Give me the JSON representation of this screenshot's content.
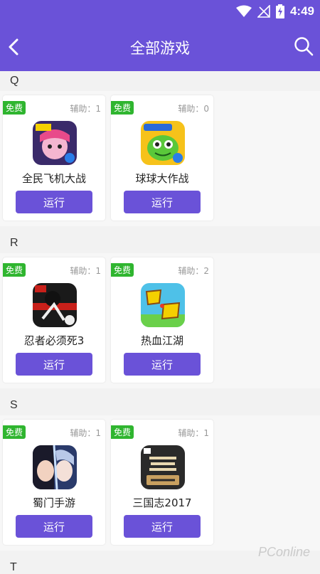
{
  "status_bar": {
    "time": "4:49"
  },
  "header": {
    "title": "全部游戏"
  },
  "sections": [
    {
      "letter": "Q",
      "games": [
        {
          "badge": "免费",
          "assist": "辅助：1",
          "name": "全民飞机大战",
          "button": "运行"
        },
        {
          "badge": "免费",
          "assist": "辅助：0",
          "name": "球球大作战",
          "button": "运行"
        }
      ]
    },
    {
      "letter": "R",
      "games": [
        {
          "badge": "免费",
          "assist": "辅助：1",
          "name": "忍者必须死3",
          "button": "运行"
        },
        {
          "badge": "免费",
          "assist": "辅助：2",
          "name": "热血江湖",
          "button": "运行"
        }
      ]
    },
    {
      "letter": "S",
      "games": [
        {
          "badge": "免费",
          "assist": "辅助：1",
          "name": "蜀门手游",
          "button": "运行"
        },
        {
          "badge": "免费",
          "assist": "辅助：1",
          "name": "三国志2017",
          "button": "运行"
        }
      ]
    },
    {
      "letter": "T",
      "games": []
    }
  ],
  "icons": {
    "back": "chevron-left-icon",
    "search": "search-icon",
    "wifi": "wifi-icon",
    "signal": "no-signal-icon",
    "battery": "battery-charging-icon"
  },
  "colors": {
    "accent": "#6a52d8",
    "badge": "#2fb52f"
  },
  "watermark": "PConline"
}
